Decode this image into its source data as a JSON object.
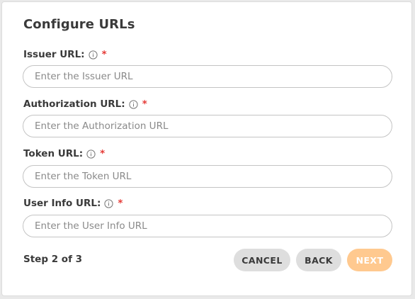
{
  "dialog": {
    "title": "Configure URLs",
    "fields": [
      {
        "label": "Issuer URL:",
        "required_mark": "*",
        "placeholder": "Enter the Issuer URL",
        "value": ""
      },
      {
        "label": "Authorization URL:",
        "required_mark": "*",
        "placeholder": "Enter the Authorization URL",
        "value": ""
      },
      {
        "label": "Token URL:",
        "required_mark": "*",
        "placeholder": "Enter the Token URL",
        "value": ""
      },
      {
        "label": "User Info URL:",
        "required_mark": "*",
        "placeholder": "Enter the User Info URL",
        "value": ""
      }
    ],
    "footer": {
      "step_text": "Step 2 of 3",
      "cancel_label": "CANCEL",
      "back_label": "BACK",
      "next_label": "NEXT"
    }
  },
  "icons": {
    "field_info": "info-circle-icon"
  },
  "colors": {
    "required": "#e53935",
    "primary_disabled": "#ffc98f",
    "secondary_button": "#dedede",
    "text": "#3a3a3a"
  }
}
